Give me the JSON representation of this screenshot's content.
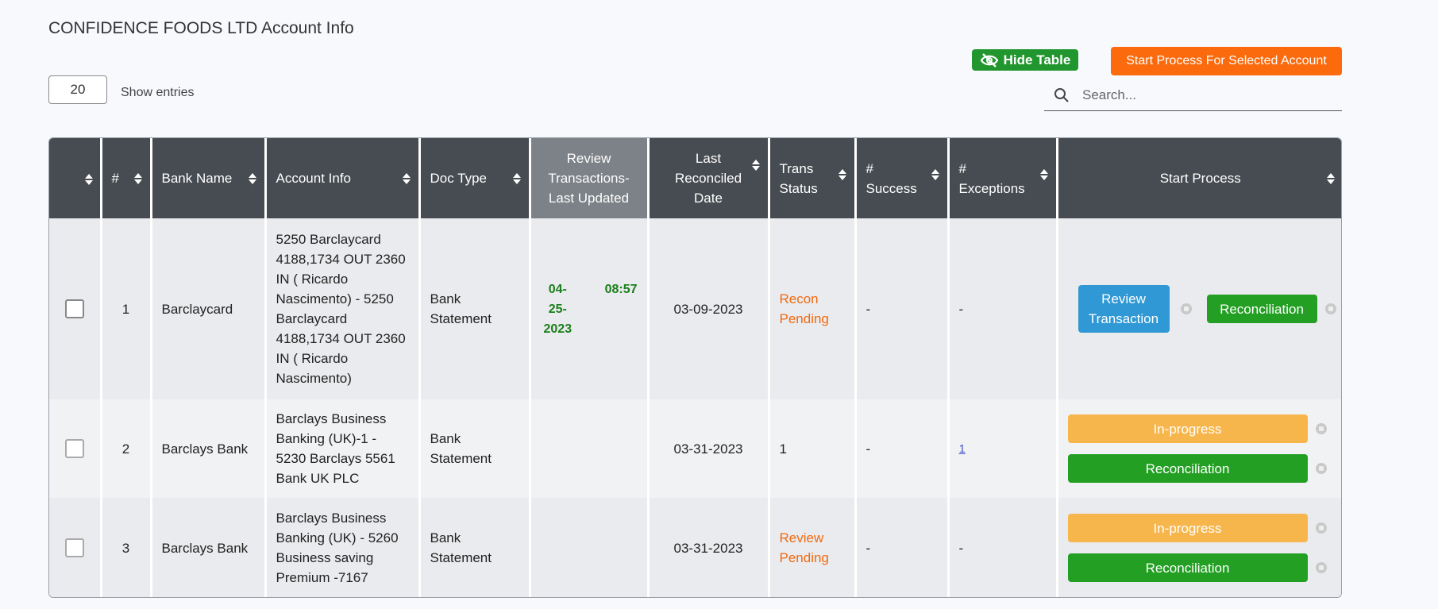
{
  "page": {
    "title": "CONFIDENCE FOODS LTD Account Info"
  },
  "entries": {
    "value": "20",
    "label": "Show entries"
  },
  "toolbar": {
    "hide_table_label": "Hide Table",
    "start_selected_label": "Start Process For Selected Account",
    "search_placeholder": "Search..."
  },
  "table": {
    "headers": {
      "num": "#",
      "bank_name": "Bank Name",
      "account_info": "Account Info",
      "doc_type": "Doc Type",
      "review_line1": "Review",
      "review_line2": "Transactions-",
      "review_line3": "Last Updated",
      "last_rec_line1": "Last",
      "last_rec_line2": "Reconciled",
      "last_rec_line3": "Date",
      "trans_line1": "Trans",
      "trans_line2": "Status",
      "success_line1": "#",
      "success_line2": "Success",
      "exceptions_line1": "#",
      "exceptions_line2": "Exceptions",
      "start_process": "Start Process"
    },
    "rows": [
      {
        "num": "1",
        "bank_name": "Barclaycard",
        "account_info": "5250 Barclaycard 4188,1734 OUT 2360 IN ( Ricardo Nascimento) - 5250 Barclaycard 4188,1734 OUT 2360 IN ( Ricardo Nascimento)",
        "doc_type": "Bank Statement",
        "review_date_line1": "04-",
        "review_date_line2": "25-",
        "review_date_line3": "2023",
        "review_time": "08:57",
        "last_reconciled": "03-09-2023",
        "trans_status": "Recon Pending",
        "success": "-",
        "exceptions": "-",
        "btn1": "Review Transaction",
        "btn2": "Reconciliation"
      },
      {
        "num": "2",
        "bank_name": "Barclays Bank",
        "account_info": "Barclays Business Banking (UK)-1 - 5230 Barclays 5561 Bank UK PLC",
        "doc_type": "Bank Statement",
        "last_reconciled": "03-31-2023",
        "trans_status": "1",
        "success": "-",
        "exceptions": "1",
        "btn1": "In-progress",
        "btn2": "Reconciliation"
      },
      {
        "num": "3",
        "bank_name": "Barclays Bank",
        "account_info": "Barclays Business Banking (UK) - 5260 Business saving Premium -7167",
        "doc_type": "Bank Statement",
        "last_reconciled": "03-31-2023",
        "trans_status": "Review Pending",
        "success": "-",
        "exceptions": "-",
        "btn1": "In-progress",
        "btn2": "Reconciliation"
      }
    ]
  },
  "colors": {
    "header_bg": "#474c52",
    "review_header_bg": "#7d8288",
    "hide_btn": "#22962e",
    "start_btn": "#fb6a0d",
    "review_btn": "#2f98d5",
    "recon_btn": "#23a023",
    "inprogress_btn": "#f6b64c",
    "status_orange": "#f06a12"
  }
}
